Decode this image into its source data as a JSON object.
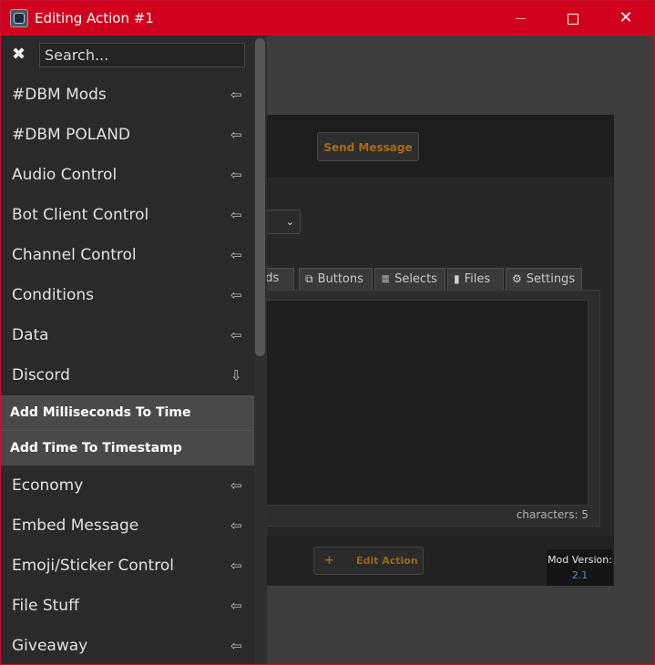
{
  "window": {
    "title": "Editing Action #1",
    "min_label": "",
    "close_label": "✕"
  },
  "dialog": {
    "send_button": "Send Message",
    "tabs": [
      {
        "label": "beds",
        "icon": ""
      },
      {
        "label": "Buttons",
        "icon": "⧉"
      },
      {
        "label": "Selects",
        "icon": "≣"
      },
      {
        "label": "Files",
        "icon": "▮"
      },
      {
        "label": "Settings",
        "icon": "⚙"
      }
    ],
    "char_count": "characters: 5",
    "edit_button": {
      "plus": "+",
      "label": "Edit Action"
    },
    "mod_version": {
      "label": "Mod Version:",
      "value": "2.1"
    }
  },
  "sidebar": {
    "search": {
      "placeholder": "Search..."
    },
    "close_icon": "✖",
    "categories": [
      {
        "label": "#DBM Mods",
        "arrow": "⇦"
      },
      {
        "label": "#DBM POLAND",
        "arrow": "⇦"
      },
      {
        "label": "Audio Control",
        "arrow": "⇦"
      },
      {
        "label": "Bot Client Control",
        "arrow": "⇦"
      },
      {
        "label": "Channel Control",
        "arrow": "⇦"
      },
      {
        "label": "Conditions",
        "arrow": "⇦"
      },
      {
        "label": "Data",
        "arrow": "⇦"
      },
      {
        "label": "Discord",
        "arrow": "⇩"
      }
    ],
    "sub_items": [
      {
        "label": "Add Milliseconds To Time"
      },
      {
        "label": "Add Time To Timestamp"
      }
    ],
    "categories_after": [
      {
        "label": "Economy",
        "arrow": "⇦"
      },
      {
        "label": "Embed Message",
        "arrow": "⇦"
      },
      {
        "label": "Emoji/Sticker Control",
        "arrow": "⇦"
      },
      {
        "label": "File Stuff",
        "arrow": "⇦"
      },
      {
        "label": "Giveaway",
        "arrow": "⇦"
      }
    ]
  }
}
